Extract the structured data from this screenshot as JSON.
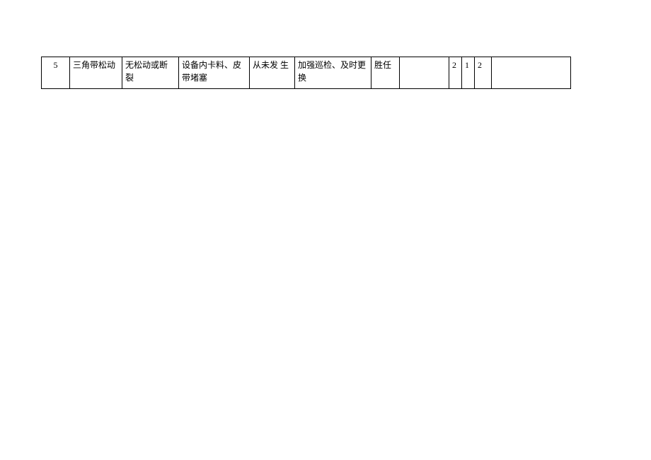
{
  "table": {
    "row": {
      "index": "5",
      "item": "三角带松动",
      "status": "无松动或断裂",
      "issue": "设备内卡料、皮带堵塞",
      "frequency": "从未发  生",
      "measure": "加强巡检、及时更换",
      "competence": "胜任",
      "blank1": "",
      "n1": "2",
      "n2": "1",
      "n3": "2",
      "blank2": ""
    }
  }
}
